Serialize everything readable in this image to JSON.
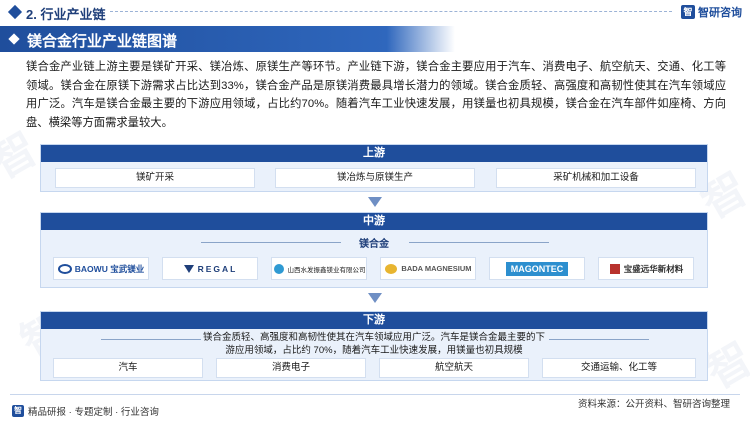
{
  "header": {
    "section_title": "2. 行业产业链",
    "brand": "智研咨询",
    "brand_mark": "智"
  },
  "title": "镁合金行业产业链图谱",
  "intro": "镁合金产业链上游主要是镁矿开采、镁冶炼、原镁生产等环节。产业链下游，镁合金主要应用于汽车、消费电子、航空航天、交通、化工等领域。镁合金在原镁下游需求占比达到33%，镁合金产品是原镁消费最具增长潜力的领域。镁合金质轻、高强度和高韧性使其在汽车领域应用广泛。汽车是镁合金最主要的下游应用领域，占比约70%。随着汽车工业快速发展，用镁量也初具规模，镁合金在汽车部件如座椅、方向盘、横梁等方面需求量较大。",
  "upstream": {
    "label": "上游",
    "items": [
      "镁矿开采",
      "镁冶炼与原镁生产",
      "采矿机械和加工设备"
    ]
  },
  "midstream": {
    "label": "中游",
    "sub_label": "镁合金",
    "companies": [
      {
        "name": "BAOWU 宝武镁业",
        "icon": "baowu-logo"
      },
      {
        "name": "REGAL",
        "icon": "regal-logo"
      },
      {
        "name": "山西水发振鑫镁业有限公司",
        "icon": "shuifa-logo"
      },
      {
        "name": "BADA MAGNESIUM",
        "icon": "bada-logo"
      },
      {
        "name": "MAGONTEC",
        "icon": "magontec-logo"
      },
      {
        "name": "宝盛远华新材料",
        "icon": "baosheng-logo"
      }
    ]
  },
  "downstream": {
    "label": "下游",
    "description_line1": "镁合金质轻、高强度和高韧性使其在汽车领域应用广泛。汽车是镁合金最主要的下",
    "description_line2": "游应用领域，占比约 70%，随着汽车工业快速发展，用镁量也初具规模",
    "items": [
      "汽车",
      "消费电子",
      "航空航天",
      "交通运输、化工等"
    ]
  },
  "footer": {
    "left_text": "精品研报 · 专题定制 · 行业咨询",
    "source": "资料来源：公开资料、智研咨询整理"
  },
  "colors": {
    "primary": "#1f4e9c",
    "panel": "#eaf1fb"
  }
}
